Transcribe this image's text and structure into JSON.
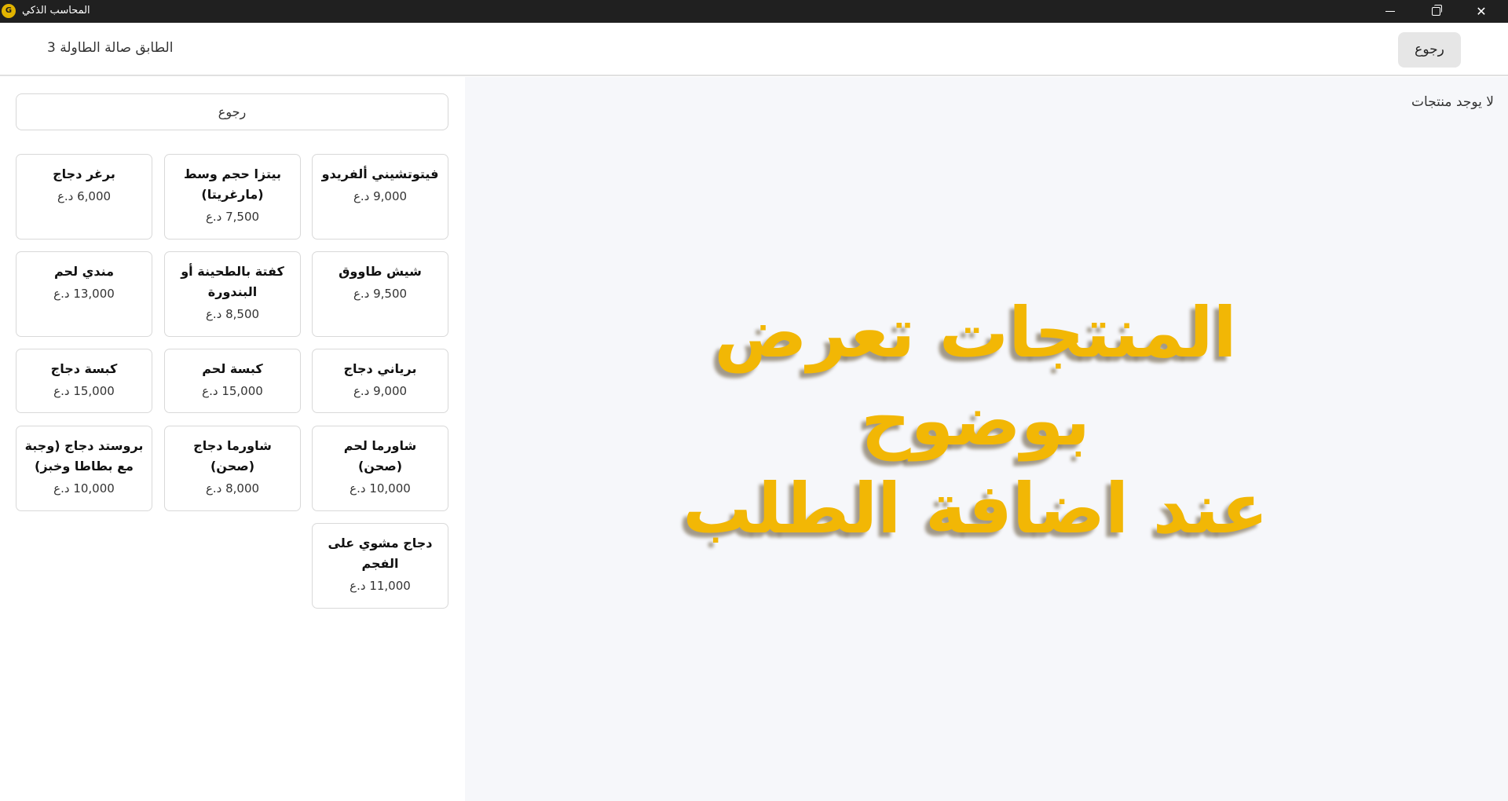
{
  "titlebar": {
    "app_name": "المحاسب الذكي",
    "logo_text": "G",
    "close_glyph": "✕"
  },
  "header": {
    "title": "الطابق صالة الطاولة 3",
    "back_label": "رجوع"
  },
  "left": {
    "back_label": "رجوع",
    "products": [
      {
        "name": "فيتوتشيني ألفريدو",
        "price": "9,000 د.ع"
      },
      {
        "name": "بيتزا حجم وسط (مارغريتا)",
        "price": "7,500 د.ع"
      },
      {
        "name": "برغر دجاج",
        "price": "6,000 د.ع"
      },
      {
        "name": "شيش طاووق",
        "price": "9,500 د.ع"
      },
      {
        "name": "كفتة بالطحينة أو البندورة",
        "price": "8,500 د.ع"
      },
      {
        "name": "مندي لحم",
        "price": "13,000 د.ع"
      },
      {
        "name": "برياني دجاج",
        "price": "9,000 د.ع"
      },
      {
        "name": "كبسة لحم",
        "price": "15,000 د.ع"
      },
      {
        "name": "كبسة دجاج",
        "price": "15,000 د.ع"
      },
      {
        "name": "شاورما لحم (صحن)",
        "price": "10,000 د.ع"
      },
      {
        "name": "شاورما دجاج (صحن)",
        "price": "8,000 د.ع"
      },
      {
        "name": "بروستد دجاج (وجبة مع بطاطا وخبز)",
        "price": "10,000 د.ع"
      },
      {
        "name": "دجاج مشوي على الفجم",
        "price": "11,000 د.ع"
      }
    ]
  },
  "right": {
    "empty_text": "لا يوجد منتجات",
    "overlay_line1": "المنتجات تعرض بوضوح",
    "overlay_line2": "عند اضافة الطلب"
  },
  "colors": {
    "overlay": "#f2b705",
    "titlebar": "#202020",
    "right_bg": "#f6f7fa"
  }
}
